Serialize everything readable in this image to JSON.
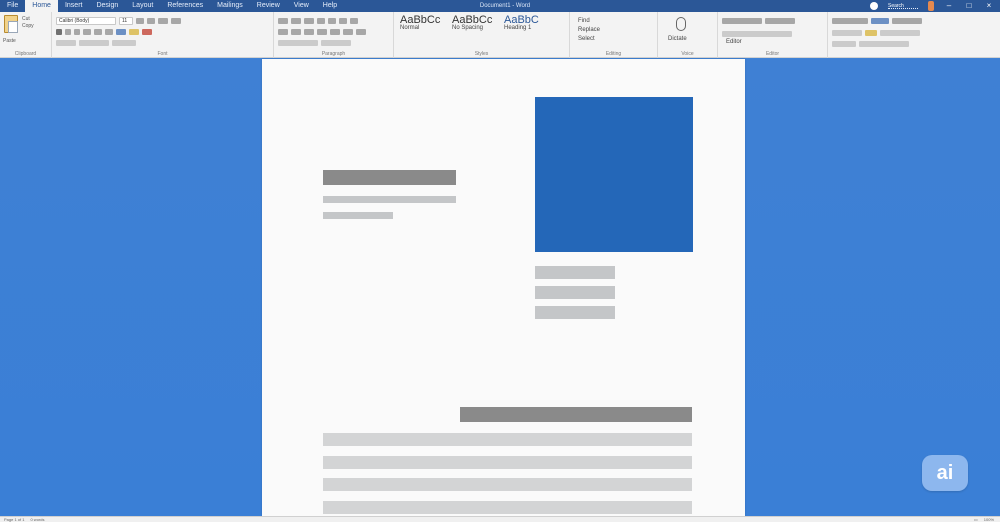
{
  "titlebar": {
    "tabs": [
      "File",
      "Home",
      "Insert",
      "Design",
      "Layout",
      "References",
      "Mailings",
      "Review",
      "View",
      "Help"
    ],
    "active_tab_index": 1,
    "document_title": "Document1 - Word",
    "search_placeholder": "Search"
  },
  "ribbon": {
    "groups": {
      "clipboard": {
        "label": "Clipboard",
        "paste_label": "Paste",
        "cut_label": "Cut",
        "copy_label": "Copy"
      },
      "font": {
        "label": "Font",
        "font_name": "Calibri (Body)",
        "font_size": "11"
      },
      "paragraph": {
        "label": "Paragraph"
      },
      "styles": {
        "label": "Styles",
        "items": [
          "Normal",
          "No Spacing",
          "Heading 1"
        ]
      },
      "editing": {
        "label": "Editing",
        "items": [
          "Find",
          "Replace",
          "Select"
        ]
      },
      "voice": {
        "label": "Voice",
        "item": "Dictate"
      },
      "editor": {
        "label": "Editor",
        "item": "Editor"
      }
    }
  },
  "statusbar": {
    "page": "Page 1 of 1",
    "words": "0 words",
    "zoom": "100%"
  },
  "badge": {
    "text": "ai"
  },
  "colors": {
    "background": "#3f82d6",
    "titlebar": "#2b5797",
    "image_placeholder": "#2467b8"
  }
}
